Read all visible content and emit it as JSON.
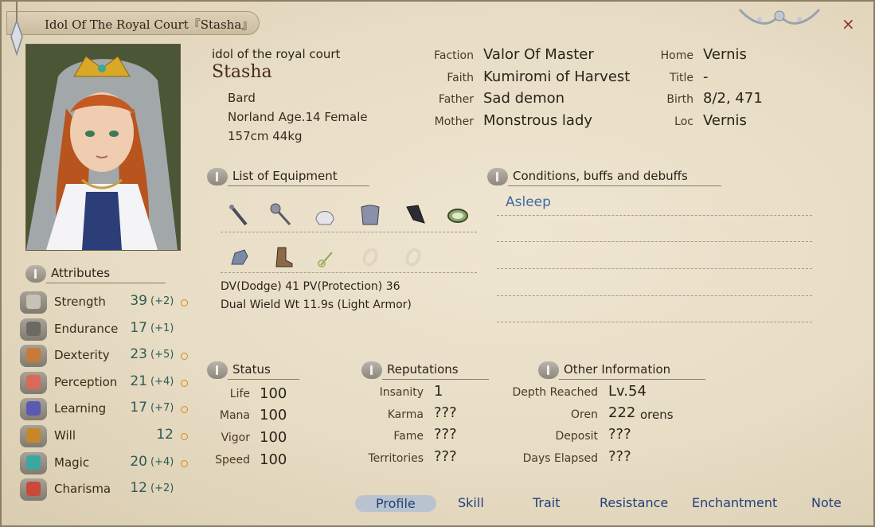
{
  "window": {
    "title": "Idol Of The Royal Court『Stasha』",
    "close": "×"
  },
  "profile": {
    "alias": "idol of the royal court",
    "name": "Stasha",
    "class": "Bard",
    "origin": "Norland Age.14 Female",
    "body": "157cm 44kg"
  },
  "bio": [
    {
      "label": "Faction",
      "value": "Valor Of Master"
    },
    {
      "label": "Faith",
      "value": "Kumiromi of Harvest"
    },
    {
      "label": "Father",
      "value": "Sad demon"
    },
    {
      "label": "Mother",
      "value": "Monstrous lady"
    }
  ],
  "bio2": [
    {
      "label": "Home",
      "value": "Vernis"
    },
    {
      "label": "Title",
      "value": "-"
    },
    {
      "label": "Birth",
      "value": "8/2, 471"
    },
    {
      "label": "Loc",
      "value": "Vernis"
    }
  ],
  "sections": {
    "attributes": "Attributes",
    "equipment": "List of Equipment",
    "conditions": "Conditions, buffs and debuffs",
    "status": "Status",
    "reputations": "Reputations",
    "other": "Other Information"
  },
  "attributes": [
    {
      "name": "Strength",
      "value": "39",
      "bonus": "(+2)",
      "dot": true,
      "color": "#c8c2b6"
    },
    {
      "name": "Endurance",
      "value": "17",
      "bonus": "(+1)",
      "dot": false,
      "color": "#6d6a66"
    },
    {
      "name": "Dexterity",
      "value": "23",
      "bonus": "(+5)",
      "dot": true,
      "color": "#c87a3a"
    },
    {
      "name": "Perception",
      "value": "21",
      "bonus": "(+4)",
      "dot": true,
      "color": "#d96a5a"
    },
    {
      "name": "Learning",
      "value": "17",
      "bonus": "(+7)",
      "dot": true,
      "color": "#5a5ab0"
    },
    {
      "name": "Will",
      "value": "12",
      "bonus": "",
      "dot": true,
      "color": "#c8862a"
    },
    {
      "name": "Magic",
      "value": "20",
      "bonus": "(+4)",
      "dot": true,
      "color": "#3aa8a0"
    },
    {
      "name": "Charisma",
      "value": "12",
      "bonus": "(+2)",
      "dot": false,
      "color": "#c84a3a"
    }
  ],
  "equipment": {
    "row1": [
      "staff-icon",
      "scepter-icon",
      "helmet-icon",
      "armor-icon",
      "cloak-icon",
      "belt-icon"
    ],
    "row2": [
      "gloves-icon",
      "boots-icon",
      "amulet-icon",
      "empty-ring-slot-icon",
      "empty-ring-slot-icon"
    ],
    "defense": "DV(Dodge) 41   PV(Protection) 36",
    "weight": "Dual Wield Wt 11.9s (Light Armor)"
  },
  "conditions": [
    "Asleep"
  ],
  "status": [
    {
      "label": "Life",
      "value": "100"
    },
    {
      "label": "Mana",
      "value": "100"
    },
    {
      "label": "Vigor",
      "value": "100"
    },
    {
      "label": "Speed",
      "value": "100"
    }
  ],
  "reputations": [
    {
      "label": "Insanity",
      "value": "1"
    },
    {
      "label": "Karma",
      "value": "???"
    },
    {
      "label": "Fame",
      "value": "???"
    },
    {
      "label": "Territories",
      "value": "???"
    }
  ],
  "other": [
    {
      "label": "Depth Reached",
      "value": "Lv.54",
      "unit": ""
    },
    {
      "label": "Oren",
      "value": "222",
      "unit": "orens"
    },
    {
      "label": "Deposit",
      "value": "???",
      "unit": ""
    },
    {
      "label": "Days Elapsed",
      "value": "???",
      "unit": ""
    }
  ],
  "tabs": [
    "Profile",
    "Skill",
    "Trait",
    "Resistance",
    "Enchantment",
    "Note"
  ]
}
